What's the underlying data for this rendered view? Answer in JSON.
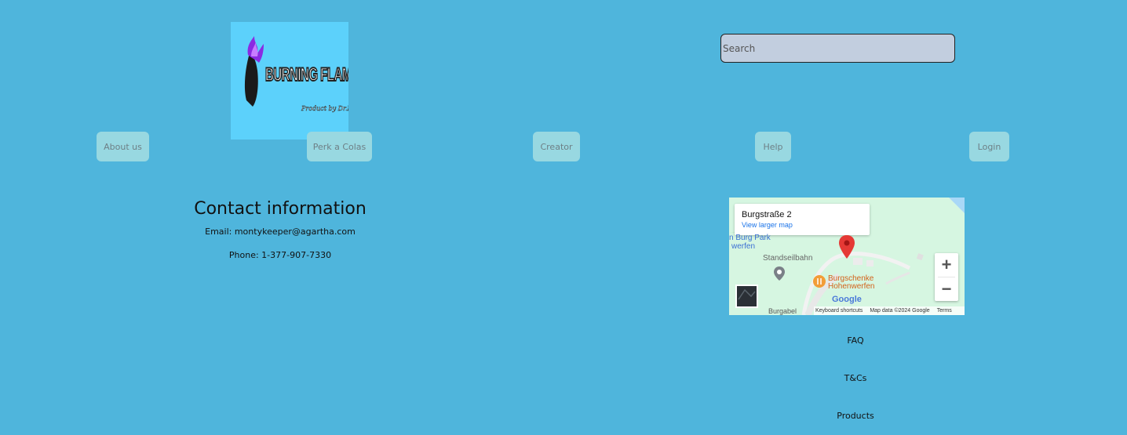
{
  "logo": {
    "title": "BURNING FLAMES SODA",
    "subtitle": "Product by Dr.Monty"
  },
  "search": {
    "placeholder": "Search",
    "value": ""
  },
  "nav": {
    "about": "About us",
    "perk": "Perk a Colas",
    "creator": "Creator",
    "help": "Help",
    "login": "Login"
  },
  "contact": {
    "title": "Contact information",
    "email": "Email: montykeeper@agartha.com",
    "phone": "Phone: 1-377-907-7330"
  },
  "map": {
    "place": "Burgstraße 2",
    "view_larger": "View larger map",
    "park_label_1": "n Burg Park",
    "park_label_2": "werfen",
    "standseilbahn": "Standseilbahn",
    "restaurant_1": "Burgschenke",
    "restaurant_2": "Hohenwerfen",
    "burgabel": "Burgabel",
    "google": "Google",
    "shortcuts": "Keyboard shortcuts",
    "map_data": "Map data ©2024 Google",
    "terms": "Terms",
    "zoom_in": "+",
    "zoom_out": "−"
  },
  "footer": {
    "faq": "FAQ",
    "tcs": "T&Cs",
    "products": "Products"
  },
  "colors": {
    "page_bg": "#4fb5dc",
    "logo_bg": "#5cd1fb",
    "button_bg": "#98d8e1",
    "search_bg": "#c2cedf",
    "map_bg": "#d6f6e1",
    "pin": "#e53935"
  }
}
